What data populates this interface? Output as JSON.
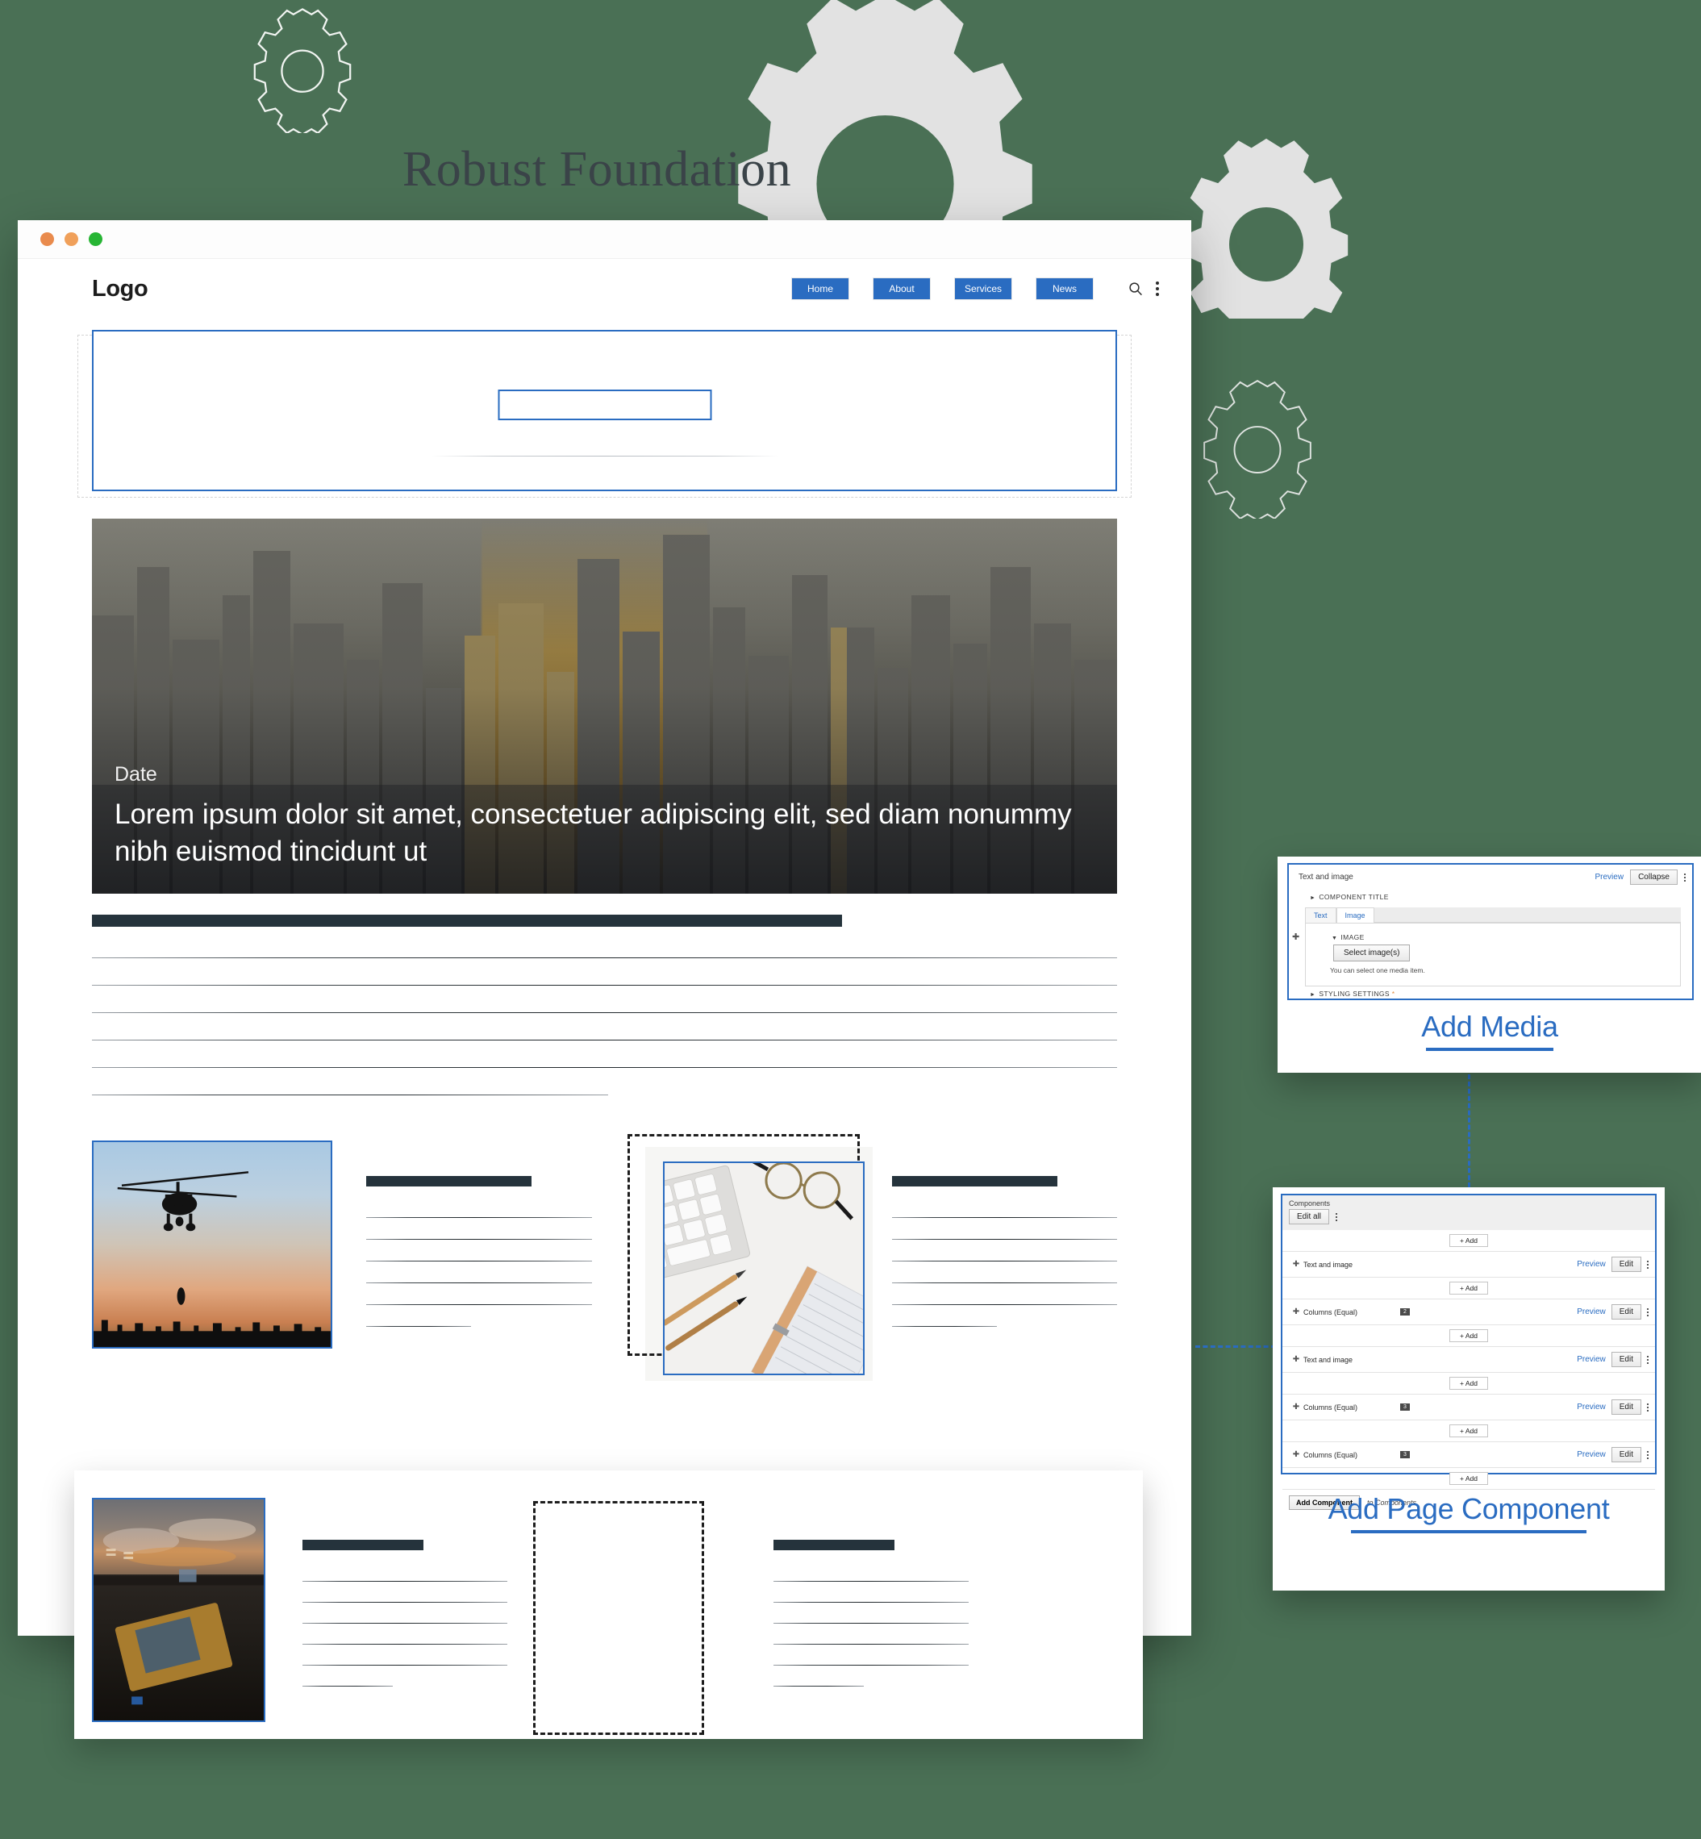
{
  "headline": "Robust Foundation",
  "browser": {
    "window_controls": [
      "close",
      "minimize",
      "maximize"
    ],
    "site": {
      "logo": "Logo",
      "nav_items": [
        "Home",
        "About",
        "Services",
        "News"
      ],
      "icons": [
        "search-icon",
        "kebab-menu-icon"
      ],
      "nav_color": "#2a6cc1"
    },
    "hero": {
      "date_label": "Date",
      "title": "Lorem ipsum dolor sit amet, consectetuer adipiscing elit, sed diam nonummy nibh euismod tincidunt ut"
    },
    "article": {
      "line_widths": [
        "100%",
        "100%",
        "100%",
        "100%",
        "100%",
        "48%"
      ]
    },
    "two_column": {
      "left_image": "helicopter-sunset-photo",
      "right_dropzone_image": "desk-keyboard-glasses-photo"
    },
    "three_column": {
      "left_image": "tennis-stadium-sunset-photo",
      "middle": "empty-dropzone"
    }
  },
  "panels": {
    "media_editor": {
      "component_label": "Text and image",
      "preview_label": "Preview",
      "collapse_label": "Collapse",
      "component_title_section": "COMPONENT TITLE",
      "tabs": [
        "Text",
        "Image"
      ],
      "active_tab": "Image",
      "image_section": "IMAGE",
      "select_button": "Select image(s)",
      "hint": "You can select one media item.",
      "styling_section": "STYLING SETTINGS",
      "required_marker": "*",
      "cta": "Add Media"
    },
    "components_panel": {
      "title": "Components",
      "edit_all_label": "Edit all",
      "add_label": "+ Add",
      "preview_label": "Preview",
      "edit_label": "Edit",
      "rows": [
        {
          "name": "Text and image",
          "count": ""
        },
        {
          "name": "Columns (Equal)",
          "count": "2"
        },
        {
          "name": "Text and image",
          "count": ""
        },
        {
          "name": "Columns (Equal)",
          "count": "3"
        },
        {
          "name": "Columns (Equal)",
          "count": "3"
        }
      ],
      "add_component_label": "Add Component",
      "add_component_suffix": "to Components",
      "cta": "Add Page Component"
    }
  },
  "colors": {
    "background": "#4a7055",
    "accent_blue": "#2a6cc1",
    "dark_bar": "#25333c",
    "gear_fill": "#e2e2e2"
  }
}
